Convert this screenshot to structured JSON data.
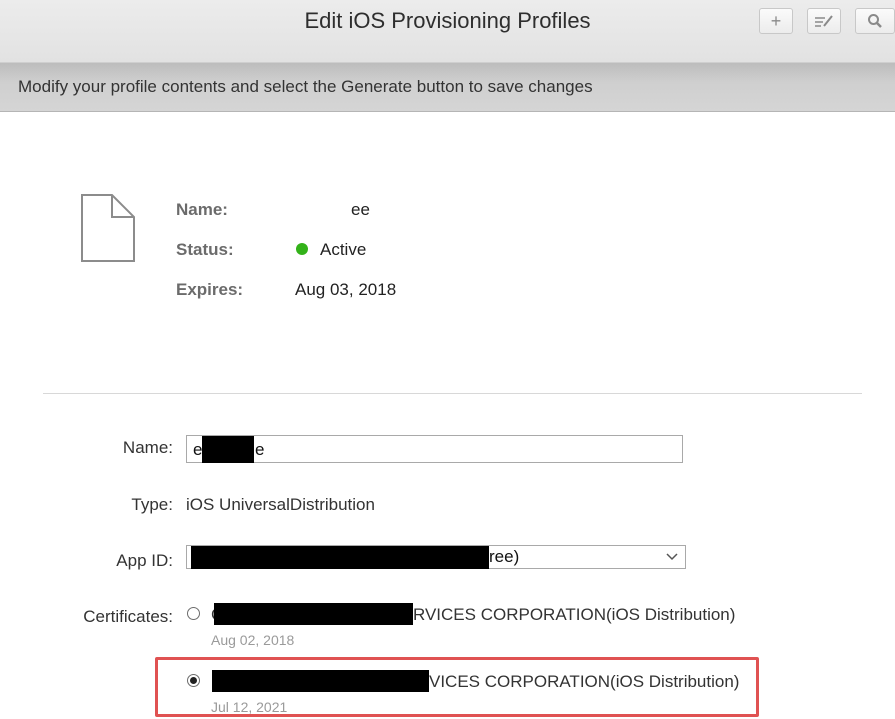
{
  "titlebar": {
    "title": "Edit iOS Provisioning Profiles",
    "buttons": [
      {
        "icon": "plus-icon",
        "glyph": "+"
      },
      {
        "icon": "edit-icon",
        "glyph": "✎"
      },
      {
        "icon": "search-icon",
        "glyph": "⌕"
      }
    ]
  },
  "subbar": {
    "text": "Modify your profile contents and select the Generate button to save changes"
  },
  "summary": {
    "name_label": "Name:",
    "name_value": "ee",
    "status_label": "Status:",
    "status_value": "Active",
    "status_color": "#33b219",
    "expires_label": "Expires:",
    "expires_value": "Aug 03, 2018"
  },
  "form": {
    "name_label": "Name:",
    "name_value_start": "e",
    "name_value_end": "e",
    "type_label": "Type:",
    "type_value": "iOS UniversalDistribution",
    "appid_label": "App ID:",
    "appid_value_end": "ree)",
    "certs_label": "Certificates:",
    "certificates": [
      {
        "prefix": "C",
        "text": "RVICES CORPORATION(iOS Distribution)",
        "date": "Aug 02, 2018",
        "selected": false
      },
      {
        "prefix": "",
        "text": "VICES CORPORATION(iOS Distribution)",
        "date": "Jul 12, 2021",
        "selected": true
      }
    ]
  },
  "colors": {
    "highlight": "#e05252"
  }
}
